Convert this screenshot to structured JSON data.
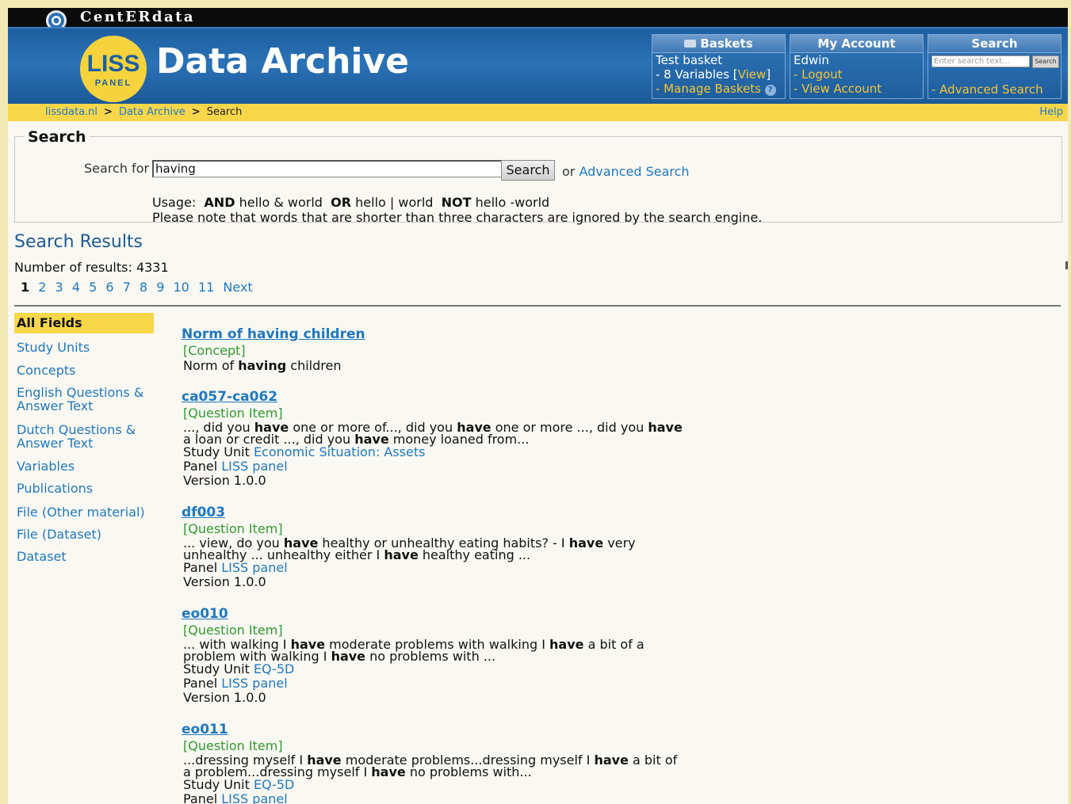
{
  "brand": {
    "company": "CentERdata",
    "logo_text": "LISS",
    "logo_sub": "PANEL",
    "title": "Data Archive"
  },
  "baskets": {
    "title": "Baskets",
    "basket_name": "Test basket",
    "variables_prefix": "- 8 Variables [",
    "view_link": "View",
    "variables_suffix": "]",
    "manage_link": "- Manage Baskets"
  },
  "account": {
    "title": "My Account",
    "user": "Edwin",
    "logout": "- Logout",
    "view_account": "- View Account"
  },
  "header_search": {
    "title": "Search",
    "placeholder": "Enter search text...",
    "button": "Search",
    "advanced": "- Advanced Search"
  },
  "breadcrumb": {
    "items": [
      "lissdata.nl",
      "Data Archive"
    ],
    "separator": ">",
    "current": "Search",
    "help": "Help"
  },
  "search": {
    "legend": "Search",
    "label": "Search for",
    "value": "having",
    "button": "Search",
    "or_text": "or",
    "advanced_link": "Advanced Search",
    "usage_prefix": "Usage:",
    "usage_and": "AND",
    "usage_and_ex": "hello & world",
    "usage_or": "OR",
    "usage_or_ex": "hello | world",
    "usage_not": "NOT",
    "usage_not_ex": "hello -world",
    "note": "Please note that words that are shorter than three characters are ignored by the search engine."
  },
  "results": {
    "title": "Search Results",
    "count_text": "Number of results: 4331",
    "pages": [
      "1",
      "2",
      "3",
      "4",
      "5",
      "6",
      "7",
      "8",
      "9",
      "10",
      "11"
    ],
    "next": "Next"
  },
  "sidebar": {
    "items": [
      "All Fields",
      "Study Units",
      "Concepts",
      "English Questions & Answer Text",
      "Dutch Questions & Answer Text",
      "Variables",
      "Publications",
      "File (Other material)",
      "File (Dataset)",
      "Dataset"
    ]
  },
  "items": [
    {
      "title": "Norm of having children",
      "type": "[Concept]",
      "line_a": "Norm of ",
      "line_b": "having",
      "line_c": " children"
    },
    {
      "title": "ca057-ca062",
      "type": "[Question Item]",
      "s1": "..., did you ",
      "s2": "have",
      "s3": " one or more of..., did you ",
      "s4": "have",
      "s5": " one or more ..., did you ",
      "s6": "have",
      "s7": "a loan or credit ..., did you ",
      "s8": "have",
      "s9": " money loaned from...",
      "study_label": "Study Unit ",
      "study": "Economic Situation: Assets",
      "panel_label": "Panel ",
      "panel": "LISS panel",
      "version": "Version 1.0.0"
    },
    {
      "title": "df003",
      "type": "[Question Item]",
      "s1": "... view, do you ",
      "s2": "have",
      "s3": " healthy or unhealthy eating habits? - I ",
      "s4": "have",
      "s5": " very",
      "s6": "unhealthy ... unhealthy either I ",
      "s7": "have",
      "s8": " healthy eating ...",
      "panel_label": "Panel ",
      "panel": "LISS panel",
      "version": "Version 1.0.0"
    },
    {
      "title": "eo010",
      "type": "[Question Item]",
      "s1": "... with walking I ",
      "s2": "have",
      "s3": " moderate problems with walking I ",
      "s4": "have",
      "s5": " a bit of a",
      "s6": "problem with walking I ",
      "s7": "have",
      "s8": " no problems with ...",
      "study_label": "Study Unit ",
      "study": "EQ-5D",
      "panel_label": "Panel ",
      "panel": "LISS panel",
      "version": "Version 1.0.0"
    },
    {
      "title": "eo011",
      "type": "[Question Item]",
      "s1": "...dressing myself I ",
      "s2": "have",
      "s3": " moderate problems...dressing myself I ",
      "s4": "have",
      "s5": " a bit of",
      "s6": "a problem...dressing myself I ",
      "s7": "have",
      "s8": " no problems with...",
      "study_label": "Study Unit ",
      "study": "EQ-5D",
      "panel_label": "Panel ",
      "panel": "LISS panel"
    }
  ]
}
